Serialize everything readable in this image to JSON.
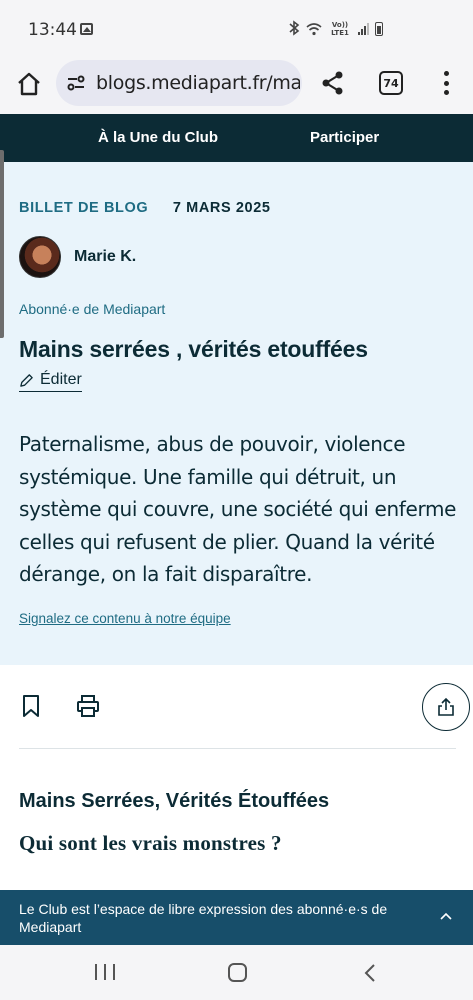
{
  "status_bar": {
    "time": "13:44",
    "network": "Vo)) LTE1",
    "icons": [
      "gallery-icon",
      "bluetooth-icon",
      "wifi-icon",
      "signal-icon",
      "battery-icon"
    ]
  },
  "browser": {
    "url": "blogs.mediapart.fr/mar",
    "tab_count": "74",
    "icons": [
      "home-icon",
      "site-settings-icon",
      "share-icon",
      "tabs-icon",
      "more-icon"
    ]
  },
  "club_nav": {
    "items": [
      {
        "label": "À la Une du Club"
      },
      {
        "label": "Participer"
      }
    ],
    "background": "#0c2b35"
  },
  "post": {
    "type_label": "BILLET DE BLOG",
    "date": "7 MARS 2025",
    "author": "Marie K.",
    "author_status": "Abonné·e de Mediapart",
    "title": "Mains serrées , vérités etouffées",
    "edit_label": "Éditer",
    "chapo": "Paternalisme, abus de pouvoir, violence systémique. Une famille qui détruit, un système qui couvre, une société qui enferme celles qui refusent de plier. Quand la vérité dérange, on la fait disparaître.",
    "report_link": "Signalez ce contenu à notre équipe",
    "panel_background": "#e9f4fb",
    "accent": "#1f6c83"
  },
  "actions": {
    "icons": [
      "bookmark-icon",
      "print-icon",
      "share-icon"
    ]
  },
  "article": {
    "heading": "Mains Serrées, Vérités Étouffées",
    "subheading": "Qui sont les vrais monstres ?"
  },
  "club_banner": {
    "text": "Le Club est l’espace de libre expression des abonné·e·s de Mediapart",
    "background": "#174e6a",
    "icon": "chevron-up-icon"
  },
  "android_nav": {
    "icons": [
      "recent-apps-icon",
      "home-icon",
      "back-icon"
    ]
  }
}
